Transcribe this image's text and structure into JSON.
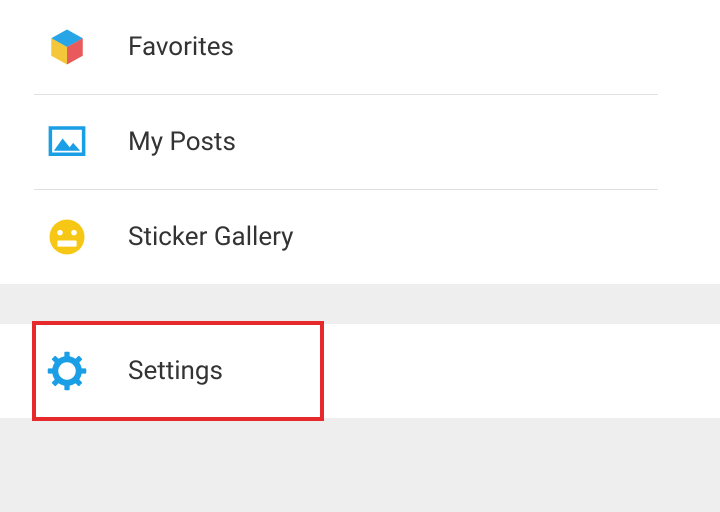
{
  "menu": {
    "favorites": {
      "label": "Favorites"
    },
    "my_posts": {
      "label": "My Posts"
    },
    "sticker_gallery": {
      "label": "Sticker Gallery"
    },
    "settings": {
      "label": "Settings"
    }
  },
  "highlight": {
    "target": "settings"
  }
}
